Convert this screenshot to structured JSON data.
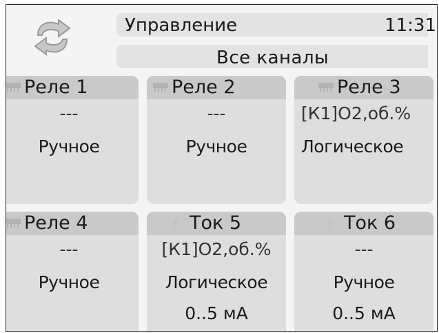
{
  "header": {
    "title": "Управление",
    "clock": "11:31",
    "subtitle": "Все каналы",
    "icon": "sync-arrows-icon"
  },
  "tiles": [
    {
      "name": "Реле 1",
      "icon": "relay-icon",
      "line1": "---",
      "line2": "Ручное",
      "line3": ""
    },
    {
      "name": "Реле 2",
      "icon": "relay-icon",
      "line1": "---",
      "line2": "Ручное",
      "line3": ""
    },
    {
      "name": "Реле 3",
      "icon": "relay-icon",
      "line1": "[К1]О2,об.%",
      "line2": "Логическое",
      "line3": ""
    },
    {
      "name": "Реле 4",
      "icon": "relay-icon",
      "line1": "---",
      "line2": "Ручное",
      "line3": ""
    },
    {
      "name": "Ток 5",
      "icon": "lightning-icon",
      "line1": "[К1]О2,об.%",
      "line2": "Логическое",
      "line3": "0..5 мА"
    },
    {
      "name": "Ток 6",
      "icon": "lightning-icon",
      "line1": "---",
      "line2": "Ручное",
      "line3": "0..5 мА"
    }
  ],
  "colors": {
    "tile": "#dedede",
    "caption": "#c9c9c9",
    "header": "#e3e3e3",
    "icon": "#a9a9a9"
  }
}
